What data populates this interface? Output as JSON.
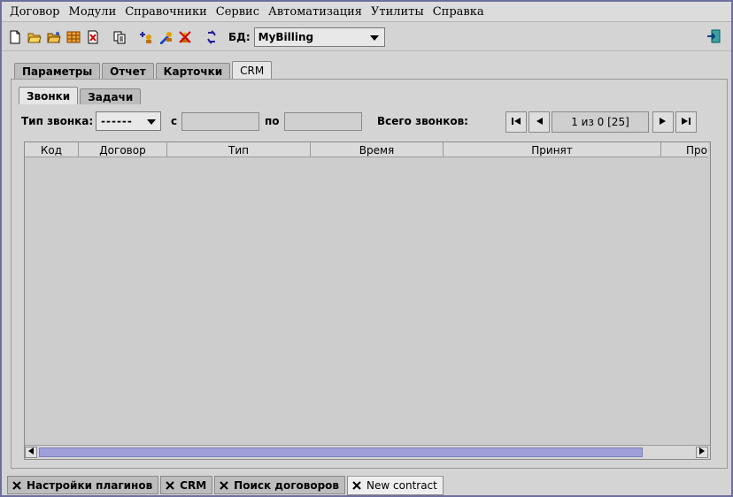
{
  "menu": [
    "Договор",
    "Модули",
    "Справочники",
    "Сервис",
    "Автоматизация",
    "Утилиты",
    "Справка"
  ],
  "toolbar": {
    "icons": [
      "new-document-icon",
      "open-folder-icon",
      "open-folder-alt-icon",
      "table-icon",
      "delete-document-icon",
      "copy-icon",
      "add-user-icon",
      "edit-user-icon",
      "remove-user-icon",
      "refresh-icon"
    ],
    "db_label": "БД:",
    "db_value": "MyBilling",
    "exit_icon": "exit-icon"
  },
  "main_tabs": [
    {
      "label": "Параметры",
      "active": false
    },
    {
      "label": "Отчет",
      "active": false
    },
    {
      "label": "Карточки",
      "active": false
    },
    {
      "label": "CRM",
      "active": true
    }
  ],
  "sub_tabs": [
    {
      "label": "Звонки",
      "active": true
    },
    {
      "label": "Задачи",
      "active": false
    }
  ],
  "filter": {
    "type_label": "Тип звонка:",
    "type_value": "------",
    "from_label": "с",
    "to_label": "по",
    "total_label": "Всего звонков:",
    "page_text": "1 из 0 [25]"
  },
  "table": {
    "columns": [
      "Код",
      "Договор",
      "Тип",
      "Время",
      "Принят",
      "Про"
    ],
    "rows": []
  },
  "bottom_tabs": [
    {
      "label": "Настройки плагинов",
      "active": false
    },
    {
      "label": "CRM",
      "active": false
    },
    {
      "label": "Поиск договоров",
      "active": false
    },
    {
      "label": "New contract",
      "active": true
    }
  ],
  "colors": {
    "background": "#d4d4d4",
    "scroll_thumb": "#9f9fd9",
    "window_border": "#6f6f9f"
  }
}
